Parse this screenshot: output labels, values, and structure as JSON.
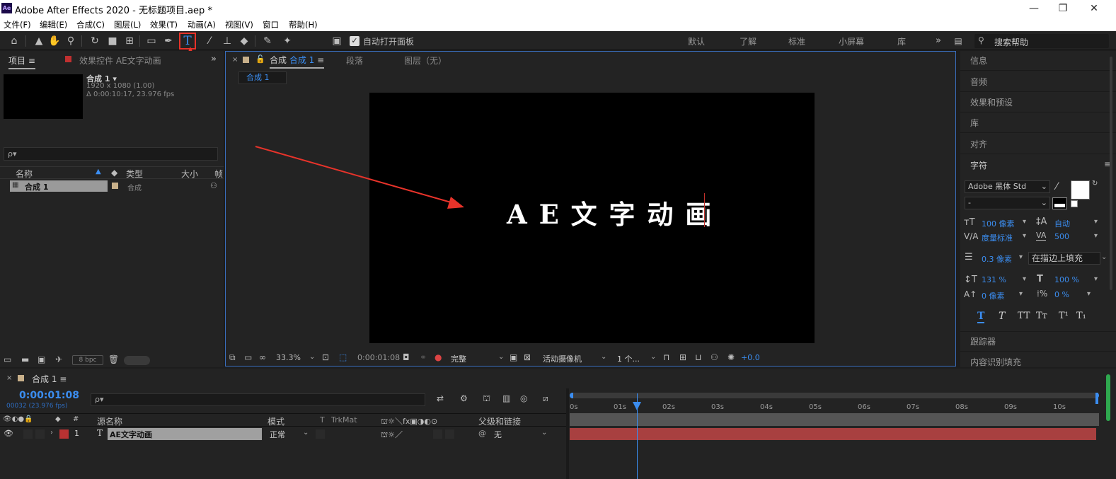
{
  "window": {
    "title": "Adobe After Effects 2020 - 无标题项目.aep *",
    "logo": "Ae"
  },
  "menu": [
    "文件(F)",
    "编辑(E)",
    "合成(C)",
    "图层(L)",
    "效果(T)",
    "动画(A)",
    "视图(V)",
    "窗口",
    "帮助(H)"
  ],
  "toolbar": {
    "auto_open_label": "自动打开面板",
    "workspaces": [
      "默认",
      "了解",
      "标准",
      "小屏幕",
      "库"
    ],
    "search_help_placeholder": "搜索帮助",
    "selected_tool": "type-tool-icon"
  },
  "project_panel": {
    "tab_project": "项目",
    "tab_effects": "效果控件 AE文字动画",
    "comp_name": "合成 1",
    "comp_dims": "1920 x 1080 (1.00)",
    "comp_duration": "Δ 0:00:10:17, 23.976 fps",
    "search_placeholder": "ρ▾",
    "col_name": "名称",
    "col_type": "类型",
    "col_size": "大小",
    "col_frame": "帧",
    "rows": [
      {
        "name": "合成 1",
        "type": "合成"
      }
    ],
    "bpc": "8 bpc"
  },
  "comp_panel": {
    "tab_label": "合成",
    "tab_comp_name": "合成 1",
    "tab_paragraph": "段落",
    "tab_layer": "图层（无）",
    "breadcrumb": "合成 1",
    "canvas_text": "A E 文 字 动 画",
    "zoom": "33.3%",
    "timecode": "0:00:01:08",
    "resolution": "完整",
    "camera": "活动摄像机",
    "views": "1 个...",
    "exposure": "+0.0"
  },
  "right_panel": {
    "items": [
      "信息",
      "音频",
      "效果和预设",
      "库",
      "对齐"
    ],
    "character_title": "字符",
    "font_family": "Adobe 黑体 Std",
    "font_style": "-",
    "font_size": "100 像素",
    "leading": "自动",
    "kerning": "度量标准",
    "tracking": "500",
    "stroke_width": "0.3 像素",
    "stroke_mode": "在描边上填充",
    "vscale": "131 %",
    "hscale": "100 %",
    "baseline": "0 像素",
    "tsume": "0 %",
    "style_buttons": [
      "T",
      "T",
      "TT",
      "Tт",
      "T¹",
      "T₁"
    ],
    "tracker": "跟踪器",
    "content_fill": "内容识别填充"
  },
  "timeline": {
    "tab_comp": "合成 1",
    "timecode": "0:00:01:08",
    "frame_info": "00032 (23.976 fps)",
    "col_source": "源名称",
    "col_mode": "模式",
    "col_t": "T",
    "col_trkmat": "TrkMat",
    "col_parent": "父级和链接",
    "layer": {
      "index": "1",
      "type": "T",
      "name": "AE文字动画",
      "mode": "正常",
      "parent": "无"
    },
    "ruler": [
      "0s",
      "01s",
      "02s",
      "03s",
      "04s",
      "05s",
      "06s",
      "07s",
      "08s",
      "09s",
      "10s"
    ]
  },
  "colors": {
    "accent_blue": "#3b8df0",
    "annotation_red": "#e8332a",
    "layer_bar": "#a83838"
  }
}
